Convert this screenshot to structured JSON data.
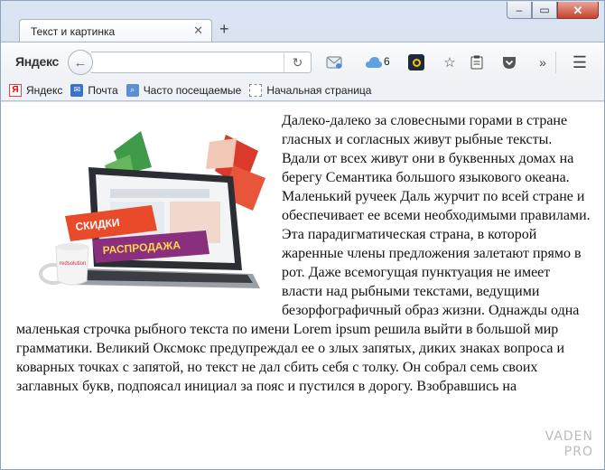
{
  "tab": {
    "title": "Текст и картинка"
  },
  "toolbar": {
    "logo_text": "Яндекс",
    "url_value": "",
    "cloud_count": "6",
    "icons": [
      "back-arrow-icon",
      "reload-icon",
      "mail-icon",
      "cloud-icon",
      "extension-icon",
      "star-icon",
      "clipboard-icon",
      "pocket-icon",
      "overflow-icon",
      "menu-icon"
    ]
  },
  "bookmarks": [
    {
      "label": "Яндекс",
      "icon": "yandex-icon"
    },
    {
      "label": "Почта",
      "icon": "mail-icon"
    },
    {
      "label": "Часто посещаемые",
      "icon": "frequent-icon"
    },
    {
      "label": "Начальная страница",
      "icon": "home-page-icon"
    }
  ],
  "content": {
    "image_texts": [
      "СКИДКИ",
      "РАСПРОДАЖА",
      "redsolution"
    ],
    "paragraph": "Далеко-далеко за словесными горами в стране гласных и согласных живут рыбные тексты. Вдали от всех живут они в буквенных домах на берегу Семантика большого языкового океана. Маленький ручеек Даль журчит по всей стране и обеспечивает ее всеми необходимыми правилами. Эта парадигматическая страна, в которой жаренные члены предложения залетают прямо в рот. Даже всемогущая пунктуация не имеет власти над рыбными текстами, ведущими безорфографичный образ жизни. Однажды одна маленькая строчка рыбного текста по имени Lorem ipsum решила выйти в большой мир грамматики. Великий Оксмокс предупреждал ее о злых запятых, диких знаках вопроса и коварных точках с запятой, но текст не дал сбить себя с толку. Он собрал семь своих заглавных букв, подпоясал инициал за пояс и пустился в дорогу. Взобравшись на"
  },
  "watermark": {
    "line1": "VADEN",
    "line2": "PRO"
  },
  "colors": {
    "window_frame": "#c9d6e7",
    "close_button": "#c7422e",
    "yandex_red": "#e61400"
  }
}
